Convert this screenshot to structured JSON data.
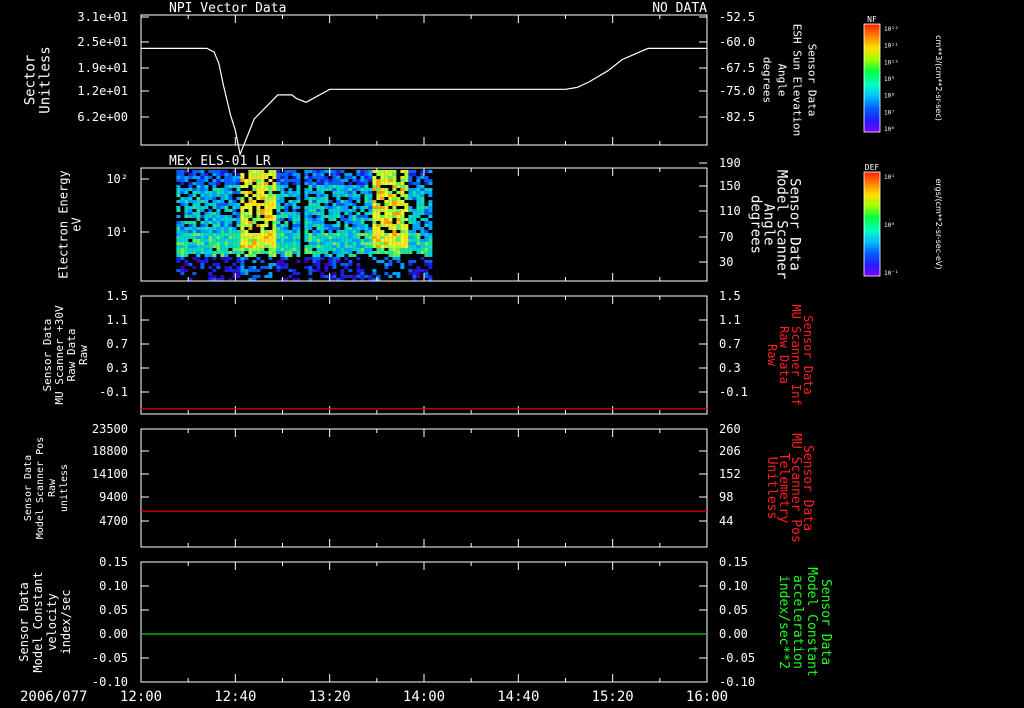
{
  "colors": {
    "background": "#000000",
    "foreground": "#ffffff",
    "red_trace": "#dd0000",
    "green_trace": "#00dd00",
    "red_label": "#ff2020",
    "green_label": "#20ff20"
  },
  "time_axis": {
    "date": "2006/077",
    "ticks": [
      "12:00",
      "12:40",
      "13:20",
      "14:00",
      "14:40",
      "15:20",
      "16:00"
    ],
    "range_min": [
      720,
      960
    ]
  },
  "colorbars": [
    {
      "label": "NF",
      "unit": "cm**3/(cm**2-sr-sec)",
      "ticks": [
        "10¹²",
        "10¹¹",
        "10¹⁰",
        "10⁹",
        "10⁸",
        "10⁷",
        "10⁶"
      ]
    },
    {
      "label": "DEF",
      "unit": "ergs/(cm**2-sr-sec-eV)",
      "ticks": [
        "10¹",
        "10⁰",
        "10⁻¹"
      ]
    }
  ],
  "panels": [
    {
      "title_left": "NPI Vector Data",
      "title_right": "NO DATA",
      "left_label": [
        "Sector",
        "Unitless"
      ],
      "right_label": [
        "Sensor Data",
        "ESH Sun Elevation",
        "Angle",
        "degrees"
      ],
      "left_ticks": [
        "3.1e+01",
        "2.5e+01",
        "1.9e+01",
        "1.2e+01",
        "6.2e+00"
      ],
      "right_ticks": [
        "-52.5",
        "-60.0",
        "-67.5",
        "-75.0",
        "-82.5"
      ]
    },
    {
      "title_left": "MEx ELS-01 LR",
      "left_label": [
        "Electron Energy",
        "eV"
      ],
      "right_label": [
        "Sensor Data",
        "Model Scanner",
        "Angle",
        "degrees"
      ],
      "left_ticks": [
        "10²",
        "10¹"
      ],
      "right_ticks": [
        "190",
        "150",
        "110",
        "70",
        "30"
      ]
    },
    {
      "left_label": [
        "Sensor Data",
        "MU Scanner +30V",
        "Raw Data",
        "Raw"
      ],
      "right_label": [
        "Sensor Data",
        "MU Scanner Inf",
        "Raw Data",
        "Raw"
      ],
      "left_ticks": [
        "1.5",
        "1.1",
        "0.7",
        "0.3",
        "-0.1"
      ],
      "right_ticks": [
        "1.5",
        "1.1",
        "0.7",
        "0.3",
        "-0.1"
      ]
    },
    {
      "left_label": [
        "Sensor Data",
        "Model Scanner Pos",
        "Raw",
        "unitless"
      ],
      "right_label": [
        "Sensor Data",
        "MU Scanner Pos",
        "Telemetry",
        "Unitless"
      ],
      "left_ticks": [
        "23500",
        "18800",
        "14100",
        "9400",
        "4700"
      ],
      "right_ticks": [
        "260",
        "206",
        "152",
        "98",
        "44"
      ]
    },
    {
      "left_label": [
        "Sensor Data",
        "Model Constant",
        "velocity",
        "index/sec"
      ],
      "right_label": [
        "Sensor Data",
        "Model Constant",
        "acceleration",
        "index/sec**2"
      ],
      "left_ticks": [
        "0.15",
        "0.10",
        "0.05",
        "0.00",
        "-0.05",
        "-0.10"
      ],
      "right_ticks": [
        "0.15",
        "0.10",
        "0.05",
        "0.00",
        "-0.05",
        "-0.10"
      ]
    }
  ],
  "chart_data": [
    {
      "type": "line",
      "series": [
        {
          "axis": "right",
          "x_min": [
            720,
            748,
            751,
            753,
            755,
            758,
            760,
            762,
            768,
            778,
            784,
            786,
            790,
            800,
            830,
            890,
            900,
            905,
            910,
            918,
            924,
            935,
            945,
            960
          ],
          "y_deg": [
            -60.0,
            -60.0,
            -61.0,
            -64.0,
            -70.0,
            -78.0,
            -82.0,
            -88.5,
            -79.0,
            -72.5,
            -72.5,
            -73.5,
            -74.5,
            -71.0,
            -71.0,
            -71.0,
            -71.0,
            -70.5,
            -69.0,
            -66.0,
            -63.0,
            -60.0,
            -60.0,
            -60.0
          ]
        }
      ],
      "ylim_right": [
        -86.0,
        -51.0
      ]
    },
    {
      "type": "heatmap",
      "x_range_min": [
        735,
        842
      ],
      "data_gap_min": [
        786,
        788
      ],
      "ylim_log": [
        0.3,
        2.25
      ],
      "bright_bands_min": [
        [
          762,
          776
        ],
        [
          818,
          832
        ]
      ]
    },
    {
      "type": "line",
      "series": [
        {
          "axis": "left",
          "x_min": [
            720,
            960
          ],
          "y": [
            -0.22,
            -0.22
          ],
          "color_key": "red_trace"
        }
      ],
      "ylim": [
        -0.3,
        1.5
      ]
    },
    {
      "type": "line",
      "series": [
        {
          "axis": "left",
          "x_min": [
            720,
            960
          ],
          "y": [
            7150,
            7150
          ],
          "color_key": "red_trace"
        }
      ],
      "ylim": [
        0,
        23500
      ]
    },
    {
      "type": "line",
      "series": [
        {
          "axis": "left",
          "x_min": [
            720,
            960
          ],
          "y": [
            0.0,
            0.0
          ],
          "color_key": "green_trace"
        }
      ],
      "ylim": [
        -0.1,
        0.15
      ]
    }
  ]
}
